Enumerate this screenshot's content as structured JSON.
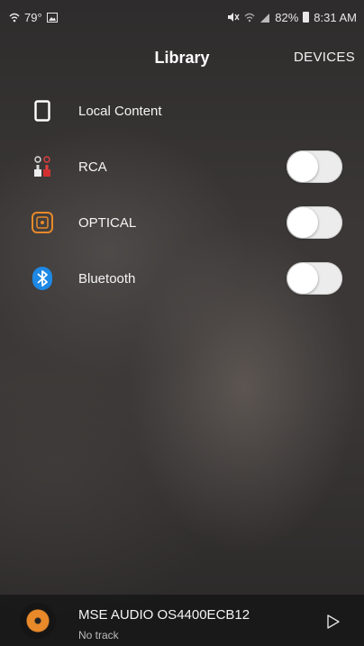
{
  "status_bar": {
    "temperature": "79°",
    "battery": "82%",
    "time": "8:31 AM"
  },
  "app_bar": {
    "title": "Library",
    "devices_label": "DEVICES"
  },
  "library": {
    "items": [
      {
        "label": "Local Content",
        "icon": "phone-icon",
        "has_toggle": false
      },
      {
        "label": "RCA",
        "icon": "rca-icon",
        "has_toggle": true,
        "enabled": false
      },
      {
        "label": "OPTICAL",
        "icon": "optical-icon",
        "has_toggle": true,
        "enabled": false
      },
      {
        "label": "Bluetooth",
        "icon": "bluetooth-icon",
        "has_toggle": true,
        "enabled": false
      }
    ]
  },
  "player": {
    "title": "MSE AUDIO OS4400ECB12",
    "subtitle": "No track"
  },
  "colors": {
    "accent_orange": "#e8892a",
    "bluetooth_blue": "#1e88e5"
  }
}
